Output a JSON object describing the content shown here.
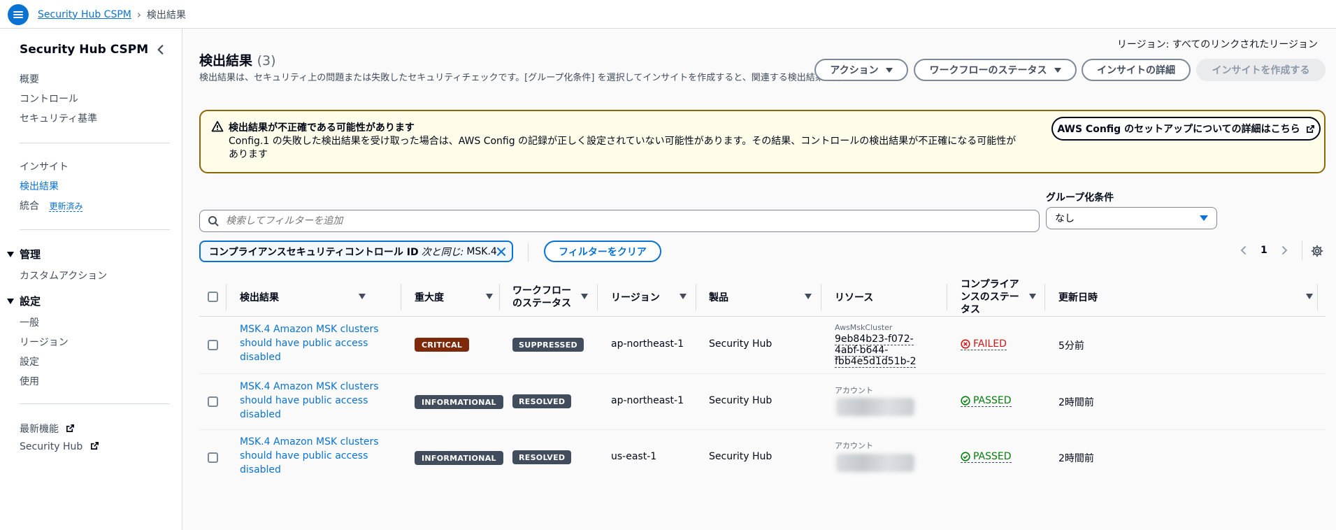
{
  "topbar": {
    "breadcrumb_root": "Security Hub CSPM",
    "breadcrumb_current": "検出結果"
  },
  "sidebar": {
    "title": "Security Hub CSPM",
    "group1": [
      "概要",
      "コントロール",
      "セキュリティ基準"
    ],
    "group2": {
      "insights": "インサイト",
      "findings": "検出結果",
      "integrations": "統合",
      "integrations_badge": "更新済み"
    },
    "management": {
      "title": "管理",
      "items": [
        "カスタムアクション"
      ]
    },
    "settings": {
      "title": "設定",
      "items": [
        "一般",
        "リージョン",
        "設定",
        "使用"
      ]
    },
    "links": [
      "最新機能",
      "Security Hub"
    ]
  },
  "header": {
    "region_label": "リージョン: すべてのリンクされたリージョン",
    "title": "検出結果",
    "count": "(3)",
    "description": "検出結果は、セキュリティ上の問題または失敗したセキュリティチェックです。[グループ化条件] を選択してインサイトを作成すると、関連する検出結果を保存できます。",
    "buttons": {
      "actions": "アクション",
      "workflow_status": "ワークフローのステータス",
      "insight_details": "インサイトの詳細",
      "create_insight": "インサイトを作成する"
    }
  },
  "warning": {
    "title": "検出結果が不正確である可能性があります",
    "text": "Config.1 の失敗した検出結果を受け取った場合は、AWS Config の記録が正しく設定されていない可能性があります。その結果、コントロールの検出結果が不正確になる可能性があります",
    "button": "AWS Config のセットアップについての詳細はこちら"
  },
  "search": {
    "placeholder": "検索してフィルターを追加"
  },
  "grouping": {
    "label": "グループ化条件",
    "value": "なし"
  },
  "filter": {
    "field": "コンプライアンスセキュリティコントロール ID",
    "operator": "次と同じ:",
    "value": "MSK.4",
    "clear_label": "フィルターをクリア"
  },
  "pagination": {
    "current_page": "1"
  },
  "table": {
    "columns": {
      "finding": "検出結果",
      "severity": "重大度",
      "workflow": "ワークフローのステータス",
      "region": "リージョン",
      "product": "製品",
      "resource": "リソース",
      "compliance": "コンプライアンスのステータス",
      "updated": "更新日時"
    },
    "rows": [
      {
        "title": "MSK.4 Amazon MSK clusters should have public access disabled",
        "severity": "CRITICAL",
        "workflow": "SUPPRESSED",
        "region": "ap-northeast-1",
        "product": "Security Hub",
        "resource_type": "AwsMskCluster",
        "resource_id": "9eb84b23-f072-4abf-b644-fbb4e5d1d51b-2",
        "compliance": "FAILED",
        "updated": "5分前"
      },
      {
        "title": "MSK.4 Amazon MSK clusters should have public access disabled",
        "severity": "INFORMATIONAL",
        "workflow": "RESOLVED",
        "region": "ap-northeast-1",
        "product": "Security Hub",
        "resource_type": "アカウント",
        "resource_id": "",
        "compliance": "PASSED",
        "updated": "2時間前"
      },
      {
        "title": "MSK.4 Amazon MSK clusters should have public access disabled",
        "severity": "INFORMATIONAL",
        "workflow": "RESOLVED",
        "region": "us-east-1",
        "product": "Security Hub",
        "resource_type": "アカウント",
        "resource_id": "",
        "compliance": "PASSED",
        "updated": "2時間前"
      }
    ]
  },
  "colors": {
    "accent": "#0972d3",
    "critical": "#7e2a0a",
    "failed": "#d91515",
    "passed": "#037f0c",
    "warning_border": "#8d6605"
  },
  "icons": [
    "menu-icon",
    "chevron-right-icon",
    "chevron-left-icon",
    "external-link-icon",
    "warning-icon",
    "search-icon",
    "close-icon",
    "gear-icon",
    "failed-icon",
    "passed-icon"
  ]
}
